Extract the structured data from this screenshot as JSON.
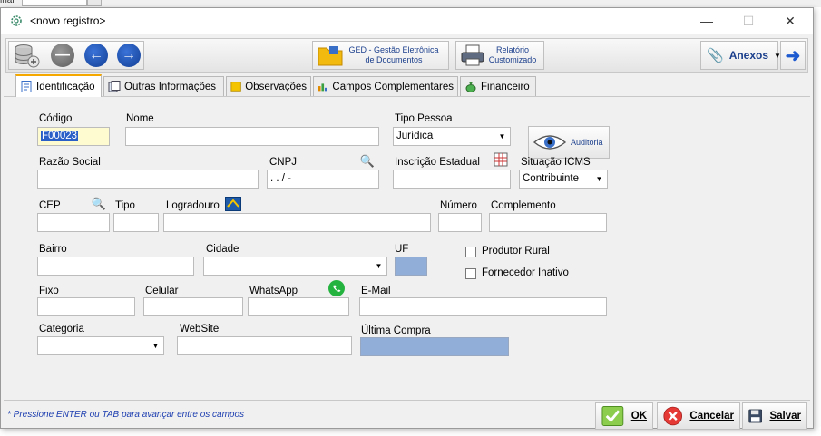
{
  "background": {
    "label": "inal"
  },
  "window": {
    "title": "<novo registro>",
    "controls": {
      "minimize": "—",
      "maximize": "☐",
      "close": "✕"
    }
  },
  "toolbar": {
    "ged_label": "GED - Gestão Eletrônica de Documentos",
    "relatorio_label": "Relatório Customizado",
    "anexos_label": "Anexos"
  },
  "tabs": [
    {
      "label": "Identificação"
    },
    {
      "label": "Outras Informações"
    },
    {
      "label": "Observações"
    },
    {
      "label": "Campos Complementares"
    },
    {
      "label": "Financeiro"
    }
  ],
  "form": {
    "codigo": {
      "label": "Código",
      "value": "F00023"
    },
    "nome": {
      "label": "Nome",
      "value": ""
    },
    "tipo_pessoa": {
      "label": "Tipo Pessoa",
      "value": "Jurídica"
    },
    "auditoria_label": "Auditoria",
    "razao_social": {
      "label": "Razão Social",
      "value": ""
    },
    "cnpj": {
      "label": "CNPJ",
      "value": " .   .   /    -"
    },
    "inscricao_estadual": {
      "label": "Inscrição Estadual",
      "value": ""
    },
    "situacao_icms": {
      "label": "Situação ICMS",
      "value": "Contribuinte"
    },
    "cep": {
      "label": "CEP",
      "value": ""
    },
    "tipo": {
      "label": "Tipo",
      "value": ""
    },
    "logradouro": {
      "label": "Logradouro",
      "value": ""
    },
    "numero": {
      "label": "Número",
      "value": ""
    },
    "complemento": {
      "label": "Complemento",
      "value": ""
    },
    "bairro": {
      "label": "Bairro",
      "value": ""
    },
    "cidade": {
      "label": "Cidade",
      "value": ""
    },
    "uf": {
      "label": "UF",
      "value": ""
    },
    "produtor_rural": {
      "label": "Produtor Rural",
      "checked": false
    },
    "fornecedor_inativo": {
      "label": "Fornecedor Inativo",
      "checked": false
    },
    "fixo": {
      "label": "Fixo",
      "value": ""
    },
    "celular": {
      "label": "Celular",
      "value": ""
    },
    "whatsapp": {
      "label": "WhatsApp",
      "value": ""
    },
    "email": {
      "label": "E-Mail",
      "value": ""
    },
    "categoria": {
      "label": "Categoria",
      "value": ""
    },
    "website": {
      "label": "WebSite",
      "value": ""
    },
    "ultima_compra": {
      "label": "Última Compra",
      "value": ""
    }
  },
  "footer": {
    "hint": "* Pressione ENTER ou TAB para avançar entre os campos",
    "ok_label": "OK",
    "cancel_label": "Cancelar",
    "save_label": "Salvar"
  },
  "colors": {
    "accent_tab": "#f5a800",
    "readonly_field": "#90aed8",
    "hint_text": "#1e3fb0",
    "button_text": "#1b3f8c"
  }
}
